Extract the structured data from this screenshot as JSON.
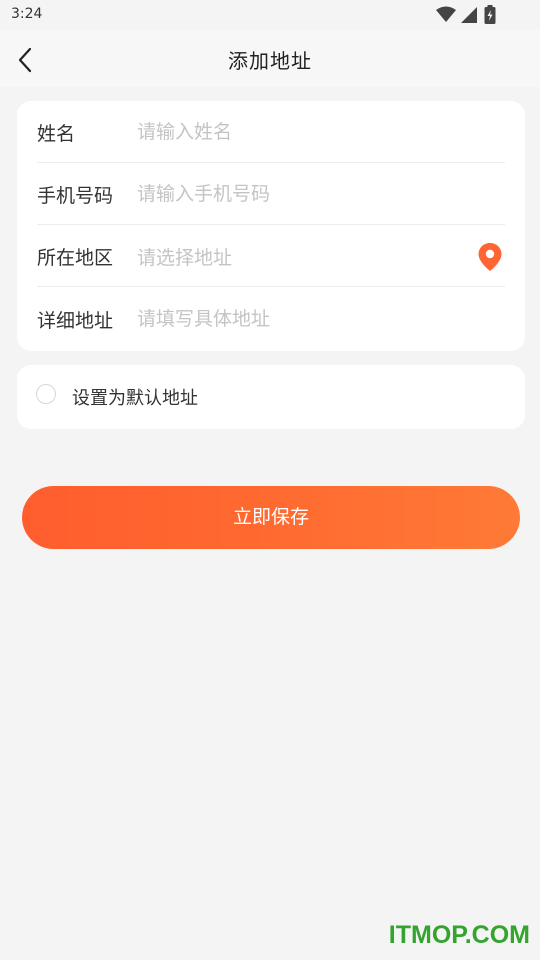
{
  "status_bar": {
    "time": "3:24",
    "icons": [
      "wifi-icon",
      "signal-icon",
      "battery-icon"
    ]
  },
  "header": {
    "title": "添加地址",
    "back_icon": "chevron-left-icon"
  },
  "form": {
    "fields": [
      {
        "label": "姓名",
        "placeholder": "请输入姓名",
        "value": ""
      },
      {
        "label": "手机号码",
        "placeholder": "请输入手机号码",
        "value": ""
      },
      {
        "label": "所在地区",
        "placeholder": "请选择地址",
        "value": "",
        "icon": "location-pin-icon"
      },
      {
        "label": "详细地址",
        "placeholder": "请填写具体地址",
        "value": ""
      }
    ]
  },
  "default_option": {
    "label": "设置为默认地址",
    "checked": false
  },
  "actions": {
    "save_label": "立即保存"
  },
  "watermark": {
    "text": "ITMOP.COM"
  },
  "colors": {
    "accent": "#ff6633",
    "background": "#f4f4f4",
    "placeholder": "#c4c4c4",
    "watermark": "#34a42e"
  }
}
